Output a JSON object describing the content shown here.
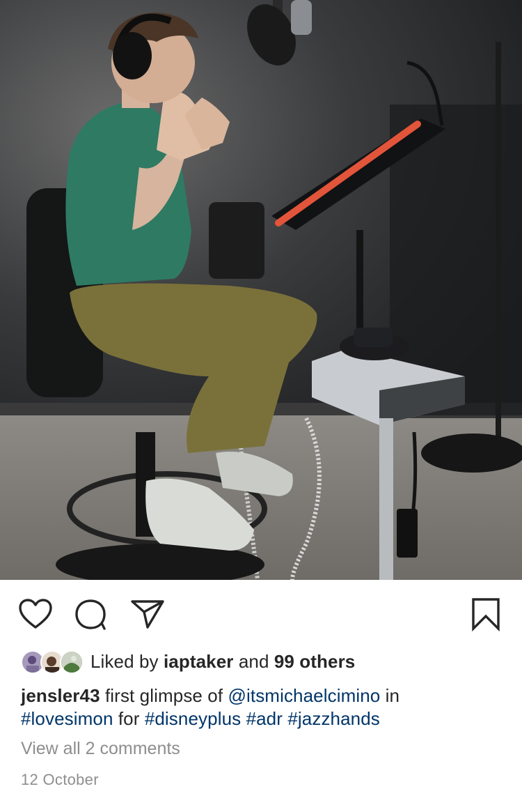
{
  "post": {
    "photo_alt": "",
    "likes": {
      "prefix": "Liked by",
      "first_liker": "iaptaker",
      "conjunction": "and",
      "others": "99 others"
    },
    "caption": {
      "username": "jensler43",
      "text_1": " first glimpse of ",
      "mention": "@itsmichaelcimino",
      "text_2": " in",
      "hashtag_1": "#lovesimon",
      "text_3": " for ",
      "hashtag_2": "#disneyplus",
      "hashtag_3": "#adr",
      "hashtag_4": "#jazzhands"
    },
    "view_comments": "View all 2 comments",
    "date": "12 October"
  },
  "icons": [
    "heart-icon",
    "comment-icon",
    "share-icon",
    "bookmark-icon"
  ],
  "colors": {
    "link": "#003569",
    "muted": "#8e8e8e",
    "text": "#262626"
  }
}
